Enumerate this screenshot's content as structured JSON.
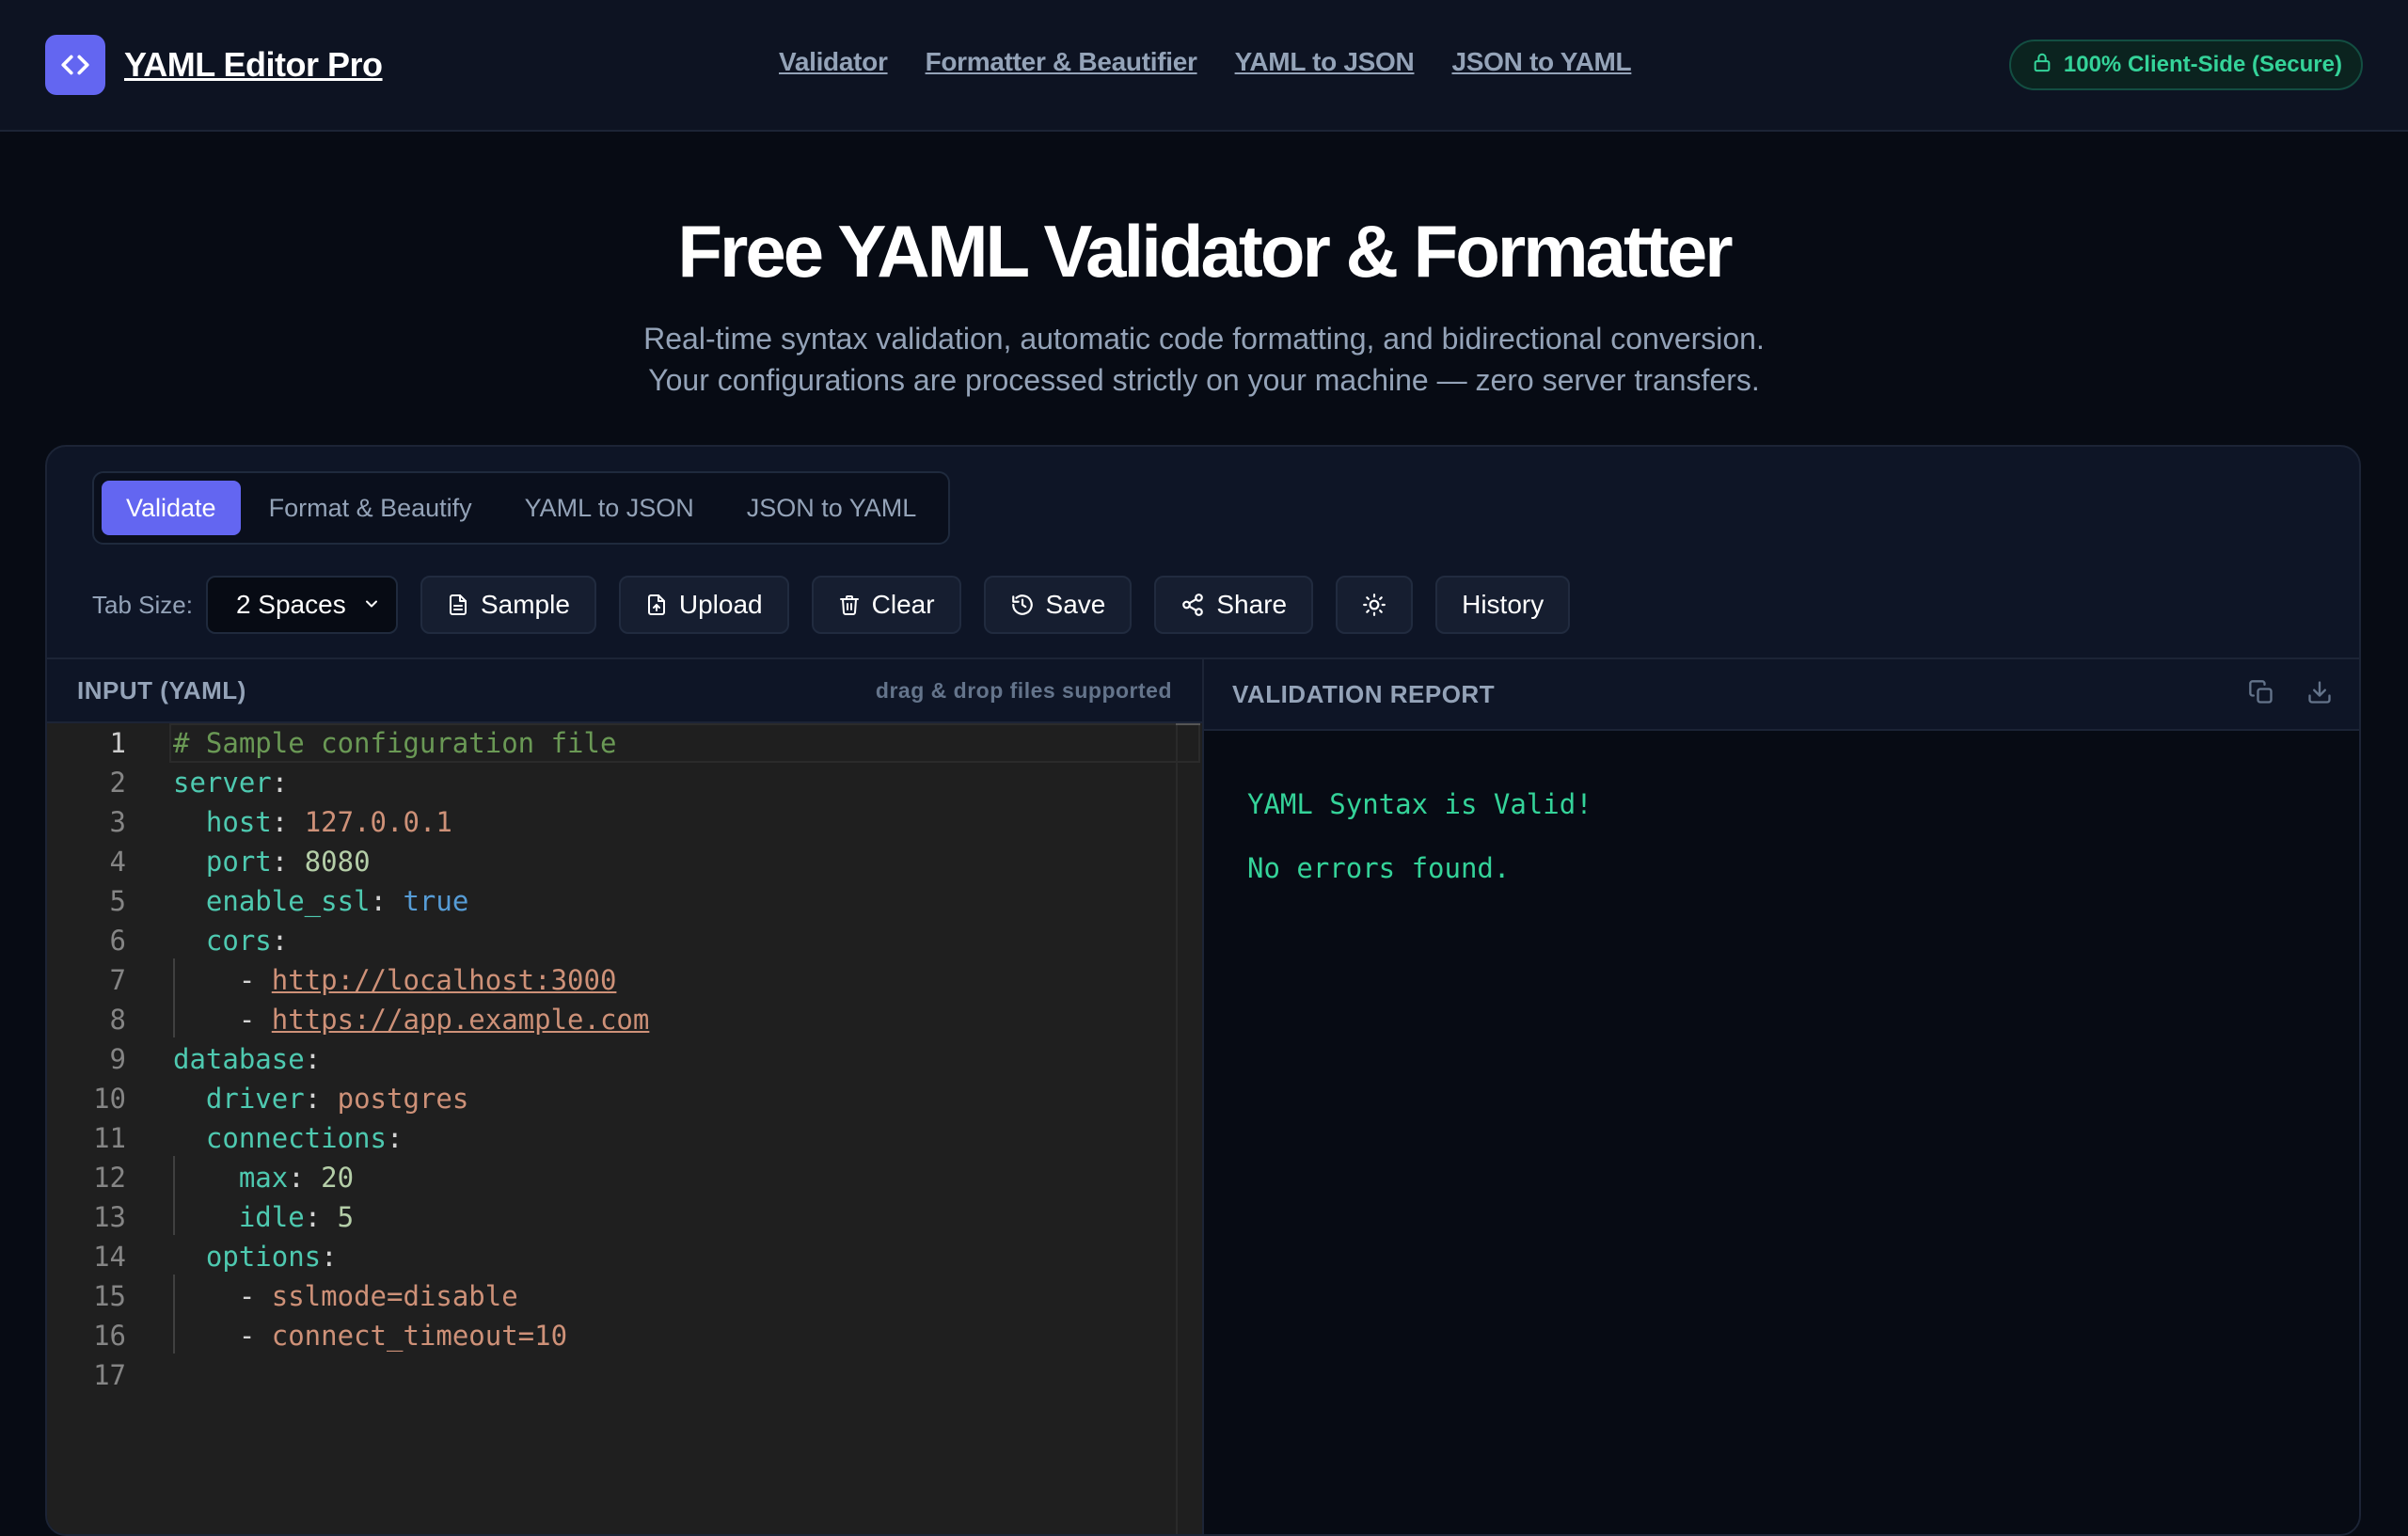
{
  "header": {
    "brand_name": "YAML Editor Pro",
    "nav": [
      "Validator",
      "Formatter & Beautifier",
      "YAML to JSON",
      "JSON to YAML"
    ],
    "secure_badge": "100% Client-Side (Secure)"
  },
  "hero": {
    "title": "Free YAML Validator & Formatter",
    "subtitle_line1": "Real-time syntax validation, automatic code formatting, and bidirectional conversion.",
    "subtitle_line2": "Your configurations are processed strictly on your machine — zero server transfers."
  },
  "tabs": [
    {
      "label": "Validate",
      "active": true
    },
    {
      "label": "Format & Beautify",
      "active": false
    },
    {
      "label": "YAML to JSON",
      "active": false
    },
    {
      "label": "JSON to YAML",
      "active": false
    }
  ],
  "toolbar": {
    "tab_size_label": "Tab Size:",
    "tab_size_value": "2 Spaces",
    "sample_label": "Sample",
    "upload_label": "Upload",
    "clear_label": "Clear",
    "save_label": "Save",
    "share_label": "Share",
    "theme_icon": "sun-icon",
    "history_label": "History"
  },
  "editor": {
    "title": "INPUT (YAML)",
    "hint": "drag & drop files supported",
    "current_line": 1,
    "line_numbers": [
      "1",
      "2",
      "3",
      "4",
      "5",
      "6",
      "7",
      "8",
      "9",
      "10",
      "11",
      "12",
      "13",
      "14",
      "15",
      "16",
      "17"
    ],
    "lines": {
      "l1_comment": "# Sample configuration file",
      "l2_key": "server",
      "l3_key": "host",
      "l3_val": "127.0.0.1",
      "l4_key": "port",
      "l4_val": "8080",
      "l5_key": "enable_ssl",
      "l5_val": "true",
      "l6_key": "cors",
      "l7_val": "http://localhost:3000",
      "l8_val": "https://app.example.com",
      "l9_key": "database",
      "l10_key": "driver",
      "l10_val": "postgres",
      "l11_key": "connections",
      "l12_key": "max",
      "l12_val": "20",
      "l13_key": "idle",
      "l13_val": "5",
      "l14_key": "options",
      "l15_val": "sslmode=disable",
      "l16_val": "connect_timeout=10"
    }
  },
  "report": {
    "title": "VALIDATION REPORT",
    "status": "YAML Syntax is Valid!",
    "detail": "No errors found."
  },
  "colors": {
    "accent": "#6366f1",
    "success": "#34d399",
    "yaml_key": "#4ec9b0",
    "yaml_string": "#ce9178",
    "yaml_number": "#b5cea8",
    "yaml_bool": "#569cd6",
    "yaml_comment": "#6a9955"
  }
}
